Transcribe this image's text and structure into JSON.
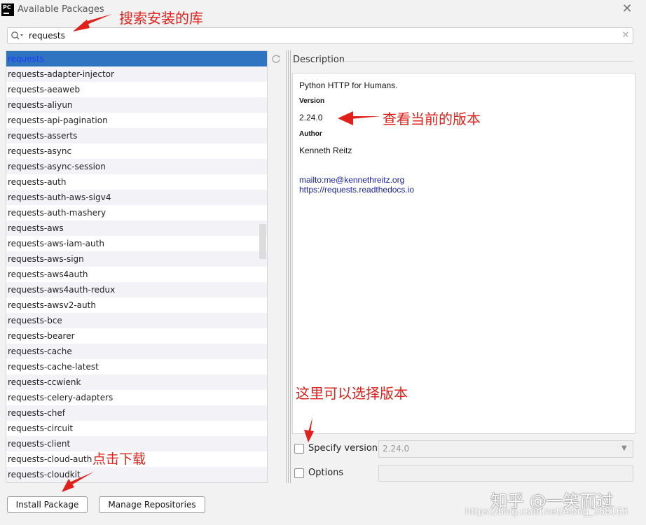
{
  "window": {
    "app_icon_text": "PC",
    "title": "Available Packages",
    "close_icon": "close-icon"
  },
  "search": {
    "value": "requests",
    "icon": "search-icon",
    "clear_icon": "clear-icon"
  },
  "packages": [
    "requests",
    "requests-adapter-injector",
    "requests-aeaweb",
    "requests-aliyun",
    "requests-api-pagination",
    "requests-asserts",
    "requests-async",
    "requests-async-session",
    "requests-auth",
    "requests-auth-aws-sigv4",
    "requests-auth-mashery",
    "requests-aws",
    "requests-aws-iam-auth",
    "requests-aws-sign",
    "requests-aws4auth",
    "requests-aws4auth-redux",
    "requests-awsv2-auth",
    "requests-bce",
    "requests-bearer",
    "requests-cache",
    "requests-cache-latest",
    "requests-ccwienk",
    "requests-celery-adapters",
    "requests-chef",
    "requests-circuit",
    "requests-client",
    "requests-cloud-auth",
    "requests-cloudkit"
  ],
  "selected_index": 0,
  "description": {
    "header": "Description",
    "summary": "Python HTTP for Humans.",
    "version_label": "Version",
    "version_value": "2.24.0",
    "author_label": "Author",
    "author_value": "Kenneth Reitz",
    "mailto": "mailto:me@kennethreitz.org",
    "url": "https://requests.readthedocs.io"
  },
  "specify_version": {
    "label": "Specify version",
    "checked": false,
    "selected": "2.24.0"
  },
  "options": {
    "label": "Options",
    "checked": false,
    "value": ""
  },
  "buttons": {
    "install": "Install Package",
    "manage": "Manage Repositories"
  },
  "annotations": {
    "search": "搜索安装的库",
    "version": "查看当前的版本",
    "select_version": "这里可以选择版本",
    "download": "点击下载",
    "color": "#e0201a"
  },
  "watermark": {
    "main": "知乎 @一笑而过",
    "url": "https://blog.csdn.net/Along_168163"
  },
  "colors": {
    "selection": "#2f74c0",
    "link": "#1a22a8",
    "background": "#f2f2f2"
  }
}
